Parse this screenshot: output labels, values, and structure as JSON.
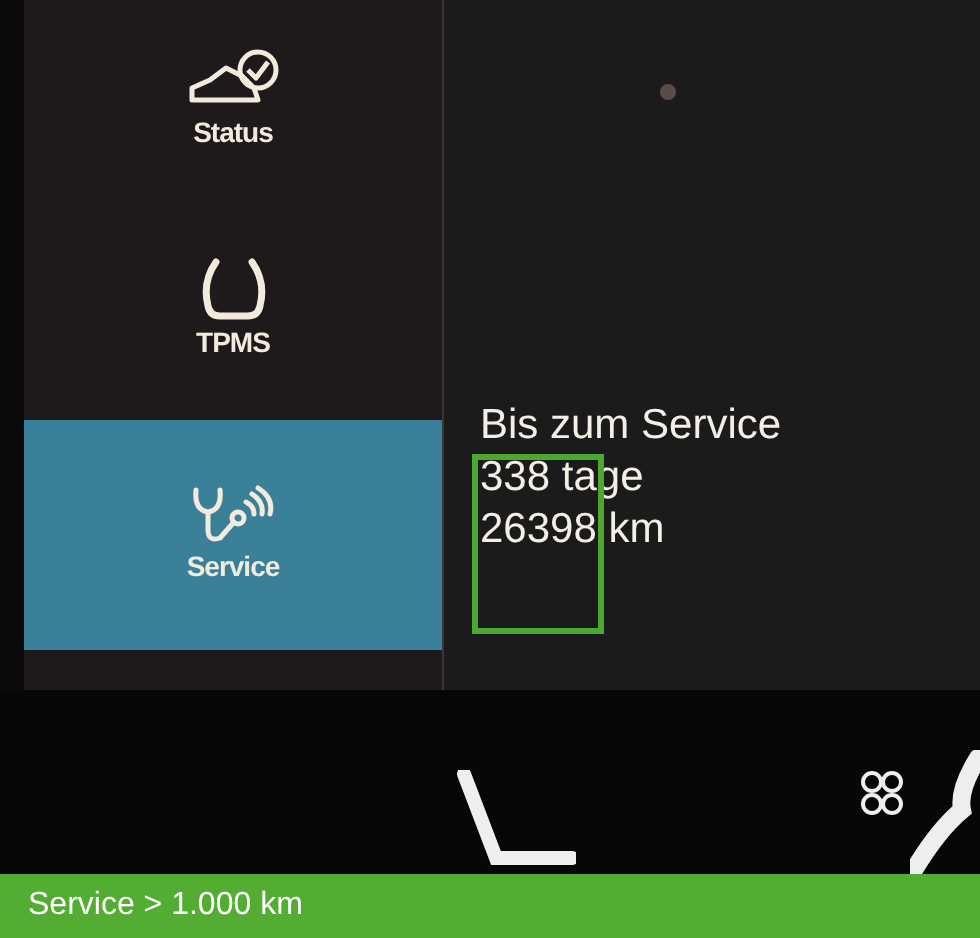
{
  "sidebar": {
    "items": [
      {
        "label": "Status",
        "kind": "car",
        "selected": false
      },
      {
        "label": "TPMS",
        "kind": "tire",
        "selected": false
      },
      {
        "label": "Service",
        "kind": "stethoscope",
        "selected": true
      }
    ]
  },
  "service_panel": {
    "title": "Bis zum Service",
    "lines": [
      "338 tage",
      "26398 km"
    ],
    "highlight_box": true
  },
  "caption": "Service > 1.000 km"
}
